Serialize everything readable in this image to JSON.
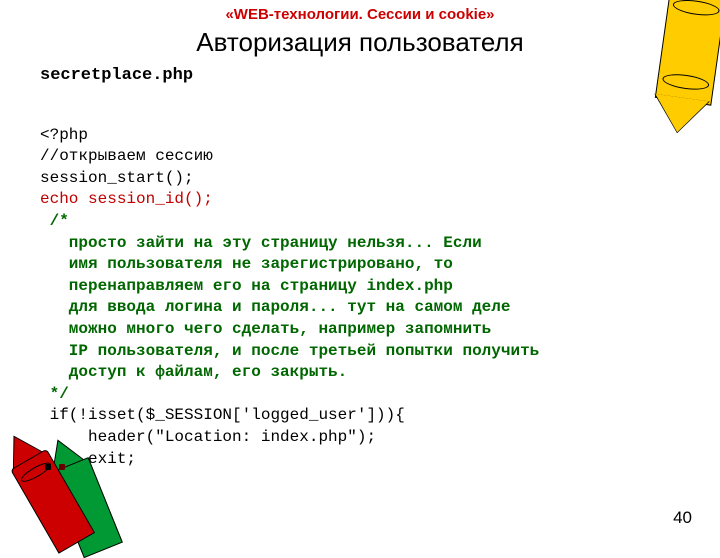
{
  "header": "«WEB-технологии. Сессии и cookie»",
  "title": "Авторизация пользователя",
  "filename": "secretplace.php",
  "code": {
    "l1": "<?php",
    "l2": "//открываем сессию",
    "l3": "session_start();",
    "l4": "echo session_id();",
    "c1": " /*",
    "c2": "   просто зайти на эту страницу нельзя... Если",
    "c3": "   имя пользователя не зарегистрировано, то",
    "c4": "   перенаправляем его на страницу index.php",
    "c5": "   для ввода логина и пароля... тут на самом деле",
    "c6": "   можно много чего сделать, например запомнить",
    "c7": "   IP пользователя, и после третьей попытки получить",
    "c8": "   доступ к файлам, его закрыть.",
    "c9": " */",
    "l5": " if(!isset($_SESSION['logged_user'])){",
    "l6": "     header(\"Location: index.php\");",
    "l7": "     exit;",
    "l8": " }",
    "l9": " ?>"
  },
  "pagenum": "40"
}
